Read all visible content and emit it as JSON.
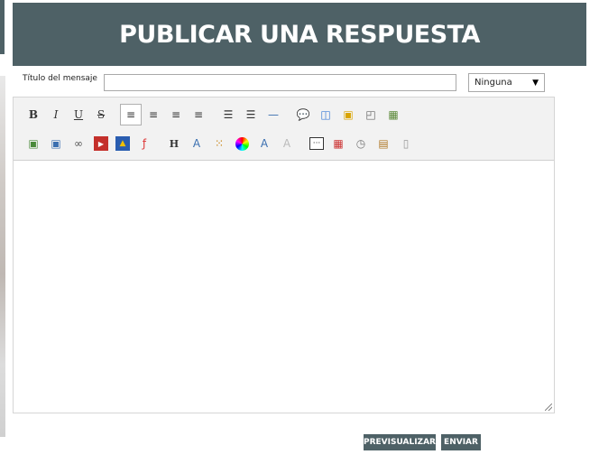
{
  "header": {
    "title": "PUBLICAR UNA RESPUESTA"
  },
  "subject": {
    "label": "Título del mensaje",
    "value": "",
    "placeholder": ""
  },
  "icon_select": {
    "selected": "Ninguna"
  },
  "toolbar": {
    "row1": [
      {
        "name": "bold-icon",
        "glyph": "B",
        "style": "bold"
      },
      {
        "name": "italic-icon",
        "glyph": "I",
        "style": "italic"
      },
      {
        "name": "underline-icon",
        "glyph": "U",
        "style": "underline"
      },
      {
        "name": "strikethrough-icon",
        "glyph": "S",
        "style": "strike"
      },
      {
        "name": "align-left-icon",
        "glyph": "≡",
        "style": "active"
      },
      {
        "name": "align-center-icon",
        "glyph": "≡"
      },
      {
        "name": "align-right-icon",
        "glyph": "≡"
      },
      {
        "name": "align-justify-icon",
        "glyph": "≡"
      },
      {
        "name": "bullet-list-icon",
        "glyph": "☰"
      },
      {
        "name": "numbered-list-icon",
        "glyph": "☰"
      },
      {
        "name": "horizontal-rule-icon",
        "glyph": "—"
      },
      {
        "name": "quote-icon",
        "glyph": "💬"
      },
      {
        "name": "code-icon",
        "glyph": "◫"
      },
      {
        "name": "spoiler-icon",
        "glyph": "▣"
      },
      {
        "name": "hide-icon",
        "glyph": "◰"
      },
      {
        "name": "table-icon",
        "glyph": "▦"
      }
    ],
    "row2": [
      {
        "name": "image-icon",
        "glyph": "▣"
      },
      {
        "name": "image-upload-icon",
        "glyph": "▣"
      },
      {
        "name": "link-icon",
        "glyph": "∞"
      },
      {
        "name": "youtube-icon",
        "glyph": "▶"
      },
      {
        "name": "dailymotion-icon",
        "glyph": "▲"
      },
      {
        "name": "flash-icon",
        "glyph": "ƒ"
      },
      {
        "name": "heading-icon",
        "glyph": "H"
      },
      {
        "name": "font-size-icon",
        "glyph": "A"
      },
      {
        "name": "color-grid-icon",
        "glyph": "⁙"
      },
      {
        "name": "color-wheel-icon",
        "glyph": "●"
      },
      {
        "name": "font-family-icon",
        "glyph": "A"
      },
      {
        "name": "remove-format-icon",
        "glyph": "A"
      },
      {
        "name": "more-icon",
        "glyph": "···"
      },
      {
        "name": "date-icon",
        "glyph": "▦"
      },
      {
        "name": "time-icon",
        "glyph": "◷"
      },
      {
        "name": "paste-icon",
        "glyph": "▤"
      },
      {
        "name": "source-icon",
        "glyph": "▯"
      }
    ]
  },
  "buttons": {
    "preview": "PREVISUALIZAR",
    "send": "ENVIAR"
  },
  "colors": {
    "header_bg": "#4e6166",
    "button_bg": "#4e6166"
  }
}
